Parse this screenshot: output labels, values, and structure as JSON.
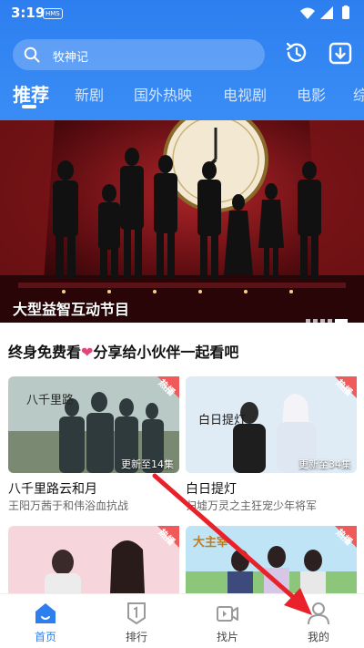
{
  "status_bar": {
    "time": "3:19",
    "badge": "HMS"
  },
  "search": {
    "query": "牧神记"
  },
  "tabs": [
    "推荐",
    "新剧",
    "国外热映",
    "电视剧",
    "电影",
    "综"
  ],
  "banner": {
    "caption": "大型益智互动节目"
  },
  "section": {
    "title_part1": "终身免费看",
    "title_part2": "分享给小伙伴一起看吧"
  },
  "cards": [
    {
      "title": "八千里路云和月",
      "subtitle": "王阳万茜于和伟浴血抗战",
      "badge": "热播",
      "episodes": "更新至14集",
      "thumb_text": "八千里路"
    },
    {
      "title": "白日提灯",
      "subtitle": "归墟万灵之主狂宠少年将军",
      "badge": "热播",
      "episodes": "更新至34集",
      "thumb_text": "白日提灯"
    },
    {
      "badge": "热播"
    },
    {
      "badge": "热播",
      "thumb_text": "大主宰"
    }
  ],
  "bottom_nav": [
    {
      "label": "首页",
      "icon": "home-icon",
      "active": true
    },
    {
      "label": "排行",
      "icon": "ranking-icon",
      "active": false
    },
    {
      "label": "找片",
      "icon": "video-icon",
      "active": false
    },
    {
      "label": "我的",
      "icon": "profile-icon",
      "active": false
    }
  ],
  "colors": {
    "primary": "#2d7ff0",
    "hot": "#f05a5a",
    "arrow": "#e8212a"
  }
}
